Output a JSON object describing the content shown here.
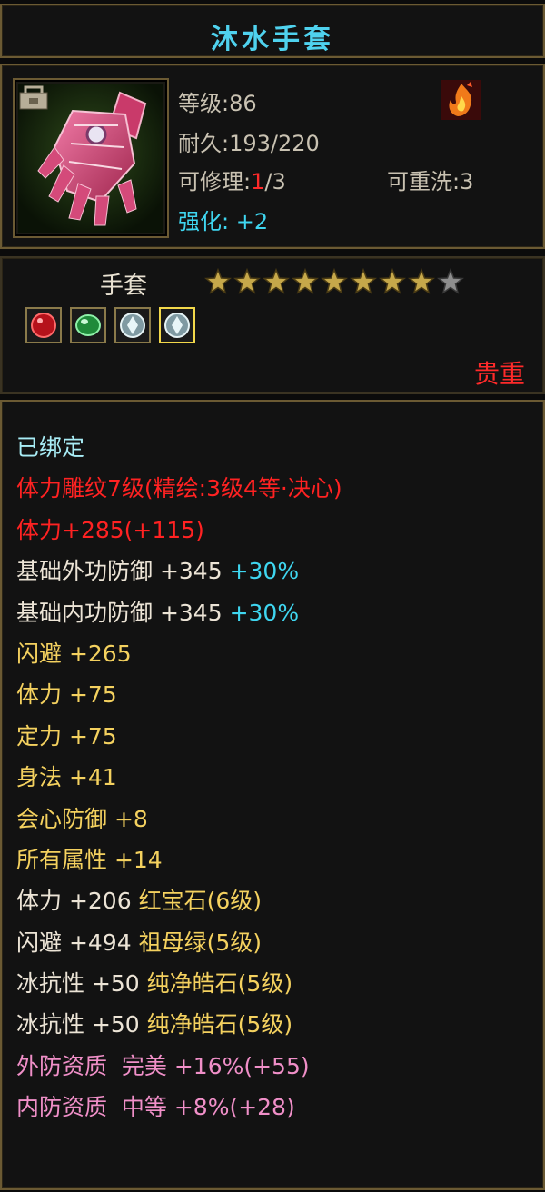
{
  "title": "沐水手套",
  "info": {
    "level": "等级:86",
    "durability": "耐久:193/220",
    "repair_label": "可修理:",
    "repair_current": "1",
    "repair_max": "/3",
    "rewash": "可重洗:3",
    "enhance": "强化: +2"
  },
  "item_type": "手套",
  "stars": {
    "filled": 8,
    "total": 9
  },
  "gems": [
    {
      "icon": "red-gem-icon"
    },
    {
      "icon": "green-gem-icon"
    },
    {
      "icon": "white-gem-icon"
    },
    {
      "icon": "white-gem-icon",
      "selected": true
    }
  ],
  "rarity": "贵重",
  "attributes": {
    "bound": "已绑定",
    "engrave": "体力雕纹7级(精绘:3级4等·决心)",
    "stamina_bonus": "体力+285(+115)",
    "ext_def": "基础外功防御 +345",
    "ext_def_pct": "+30%",
    "int_def": "基础内功防御 +345",
    "int_def_pct": "+30%",
    "lines": [
      "闪避 +265",
      "体力 +75",
      "定力 +75",
      "身法 +41",
      "会心防御 +8",
      "所有属性 +14"
    ],
    "gem_lines": [
      {
        "stat": "体力 +206",
        "gem": "红宝石(6级)"
      },
      {
        "stat": "闪避 +494",
        "gem": "祖母绿(5级)"
      },
      {
        "stat": "冰抗性 +50",
        "gem": "纯净皓石(5级)"
      },
      {
        "stat": "冰抗性 +50",
        "gem": "纯净皓石(5级)"
      }
    ],
    "ext_quality": "外防资质  完美 +16%(+55)",
    "int_quality": "内防资质  中等 +8%(+28)"
  }
}
